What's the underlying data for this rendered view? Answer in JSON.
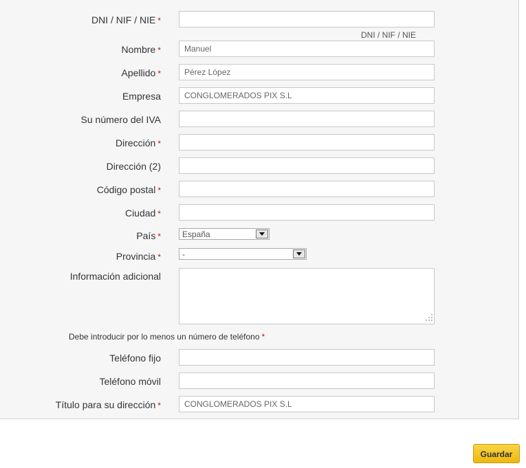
{
  "form": {
    "dni": {
      "label": "DNI / NIF / NIE",
      "required": "*",
      "value": "",
      "hint": "DNI / NIF / NIE"
    },
    "nombre": {
      "label": "Nombre",
      "required": "*",
      "value": "Manuel"
    },
    "apellido": {
      "label": "Apellido",
      "required": "*",
      "value": "Pérez López"
    },
    "empresa": {
      "label": "Empresa",
      "value": "CONGLOMERADOS PIX S.L"
    },
    "iva": {
      "label": "Su número del IVA",
      "value": ""
    },
    "direccion": {
      "label": "Dirección",
      "required": "*",
      "value": ""
    },
    "direccion2": {
      "label": "Dirección (2)",
      "value": ""
    },
    "codigo_postal": {
      "label": "Código postal",
      "required": "*",
      "value": ""
    },
    "ciudad": {
      "label": "Ciudad",
      "required": "*",
      "value": ""
    },
    "pais": {
      "label": "País",
      "required": "*",
      "selected": "España"
    },
    "provincia": {
      "label": "Provincia",
      "required": "*",
      "selected": "-"
    },
    "info": {
      "label": "Información adicional",
      "value": ""
    },
    "phone_note": {
      "text": "Debe introducir por lo menos un número de teléfono",
      "required": "*"
    },
    "telefono_fijo": {
      "label": "Teléfono fijo",
      "value": ""
    },
    "telefono_movil": {
      "label": "Teléfono móvil",
      "value": ""
    },
    "titulo": {
      "label": "Título para su dirección",
      "required": "*",
      "value": "CONGLOMERADOS PIX S.L"
    }
  },
  "actions": {
    "save_label": "Guardar"
  },
  "colors": {
    "required": "#c41414",
    "button": "#f3c623",
    "panel": "#f6f6f6"
  }
}
